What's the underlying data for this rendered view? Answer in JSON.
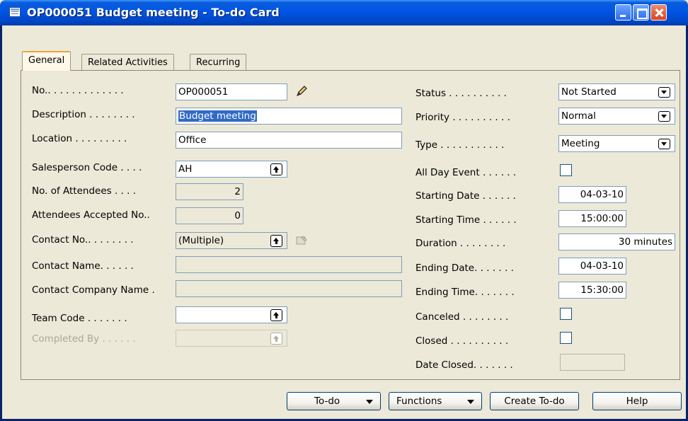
{
  "window": {
    "title": "OP000051 Budget meeting - To-do Card"
  },
  "tabs": [
    {
      "label": "General",
      "active": true
    },
    {
      "label": "Related Activities",
      "active": false
    },
    {
      "label": "Recurring",
      "active": false
    }
  ],
  "left": {
    "no": {
      "label": "No.. . . . . . . . . . . . .",
      "value": "OP000051"
    },
    "description": {
      "label": "Description . . . . . . . .",
      "value": "Budget meeting"
    },
    "location": {
      "label": "Location . . . . . . . . .",
      "value": "Office"
    },
    "salesperson": {
      "label": "Salesperson Code . . . .",
      "value": "AH"
    },
    "attendees": {
      "label": "No. of Attendees . . . .",
      "value": "2"
    },
    "accepted": {
      "label": "Attendees Accepted No..",
      "value": "0"
    },
    "contact_no": {
      "label": "Contact No.. . . . . . . .",
      "value": "(Multiple)"
    },
    "contact_name": {
      "label": "Contact Name. . . . . .",
      "value": ""
    },
    "contact_company": {
      "label": "Contact Company Name .",
      "value": ""
    },
    "team_code": {
      "label": "Team Code . . . . . . .",
      "value": ""
    },
    "completed_by": {
      "label": "Completed By . . . . . .",
      "value": ""
    }
  },
  "right": {
    "status": {
      "label": "Status . . . . . . . . . .",
      "value": "Not Started"
    },
    "priority": {
      "label": "Priority . . . . . . . . . .",
      "value": "Normal"
    },
    "type": {
      "label": "Type . . . . . . . . . . .",
      "value": "Meeting"
    },
    "all_day": {
      "label": "All Day Event . . . . . .",
      "checked": false
    },
    "start_date": {
      "label": "Starting Date . . . . . .",
      "value": "04-03-10"
    },
    "start_time": {
      "label": "Starting Time . . . . . .",
      "value": "15:00:00"
    },
    "duration": {
      "label": "Duration . . . . . . . .",
      "value": "30 minutes"
    },
    "end_date": {
      "label": "Ending Date. . . . . . .",
      "value": "04-03-10"
    },
    "end_time": {
      "label": "Ending Time. . . . . . .",
      "value": "15:30:00"
    },
    "canceled": {
      "label": "Canceled . . . . . . . .",
      "checked": false
    },
    "closed": {
      "label": "Closed . . . . . . . . . .",
      "checked": false
    },
    "date_closed": {
      "label": "Date Closed. . . . . . .",
      "value": ""
    }
  },
  "buttons": {
    "todo": "To-do",
    "functions": "Functions",
    "create": "Create To-do",
    "help": "Help"
  },
  "colors": {
    "title_bar": "#0055e5",
    "selection": "#316ac5",
    "active_tab_accent": "#e8a33b"
  }
}
